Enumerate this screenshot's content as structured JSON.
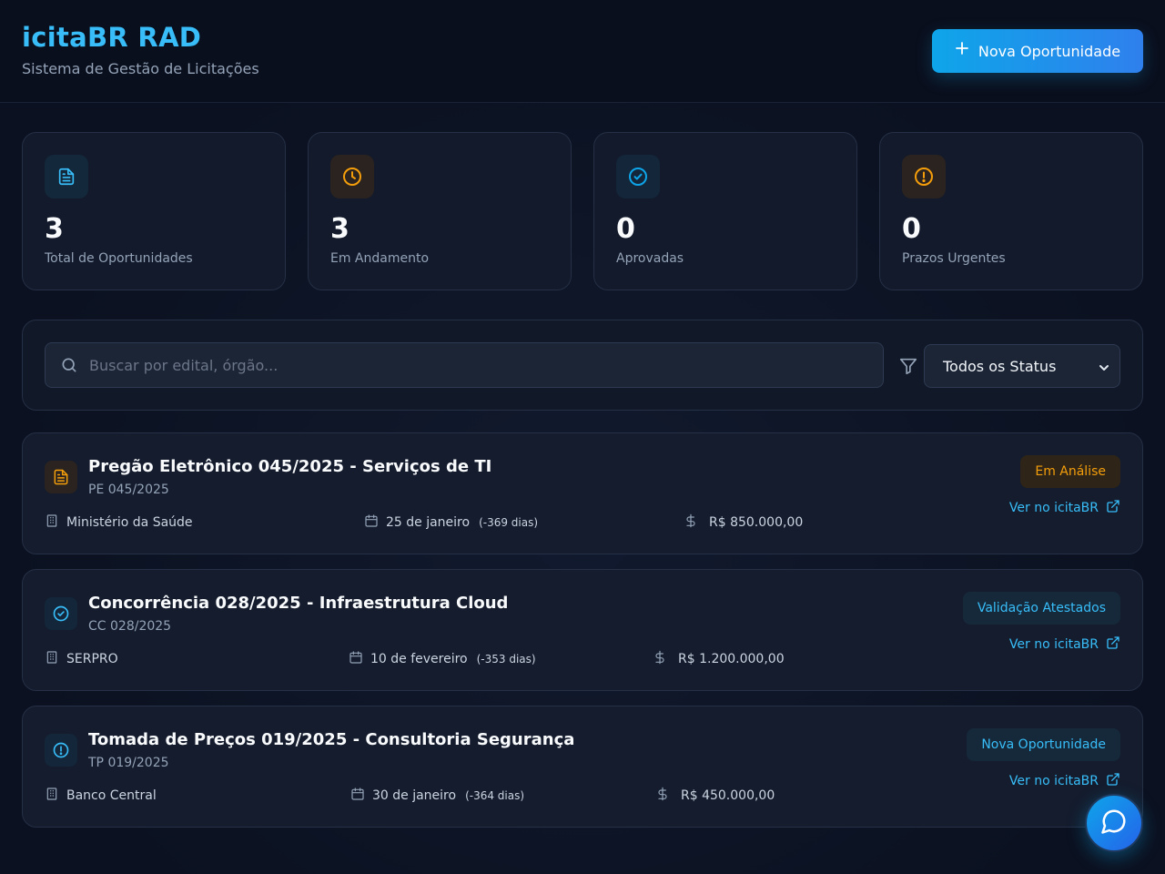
{
  "header": {
    "title": "icitaBR RAD",
    "subtitle": "Sistema de Gestão de Licitações",
    "new_button_label": "Nova Oportunidade"
  },
  "stats": [
    {
      "value": "3",
      "label": "Total de Oportunidades",
      "icon": "document-icon",
      "color": "#38bdf8"
    },
    {
      "value": "3",
      "label": "Em Andamento",
      "icon": "clock-icon",
      "color": "#f59e0b"
    },
    {
      "value": "0",
      "label": "Aprovadas",
      "icon": "check-circle-icon",
      "color": "#0ea5e9"
    },
    {
      "value": "0",
      "label": "Prazos Urgentes",
      "icon": "alert-circle-icon",
      "color": "#f59e0b"
    }
  ],
  "filters": {
    "search_placeholder": "Buscar por edital, órgão...",
    "status_selected": "Todos os Status"
  },
  "opportunities": [
    {
      "title": "Pregão Eletrônico 045/2025 - Serviços de TI",
      "code": "PE 045/2025",
      "agency": "Ministério da Saúde",
      "date": "25 de janeiro",
      "days": "(-369 dias)",
      "amount": "R$ 850.000,00",
      "status": "Em Análise",
      "status_color": "#f59e0b",
      "link": "Ver no icitaBR",
      "icon": "document-icon"
    },
    {
      "title": "Concorrência 028/2025 - Infraestrutura Cloud",
      "code": "CC 028/2025",
      "agency": "SERPRO",
      "date": "10 de fevereiro",
      "days": "(-353 dias)",
      "amount": "R$ 1.200.000,00",
      "status": "Validação Atestados",
      "status_color": "#38bdf8",
      "link": "Ver no icitaBR",
      "icon": "check-circle-icon"
    },
    {
      "title": "Tomada de Preços 019/2025 - Consultoria Segurança",
      "code": "TP 019/2025",
      "agency": "Banco Central",
      "date": "30 de janeiro",
      "days": "(-364 dias)",
      "amount": "R$ 450.000,00",
      "status": "Nova Oportunidade",
      "status_color": "#38bdf8",
      "link": "Ver no icitaBR",
      "icon": "alert-circle-icon"
    }
  ]
}
